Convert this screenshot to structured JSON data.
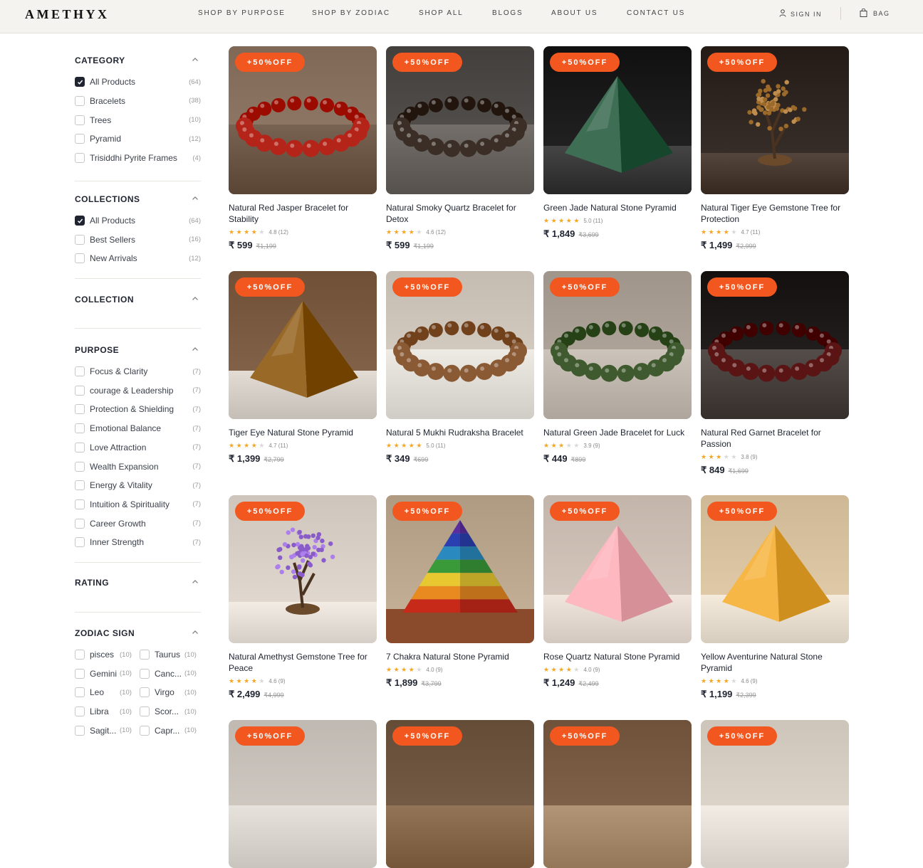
{
  "header": {
    "logo": "AMETHYX",
    "nav": [
      "SHOP BY PURPOSE",
      "SHOP BY ZODIAC",
      "SHOP ALL",
      "BLOGS",
      "ABOUT US",
      "CONTACT US"
    ],
    "sign_in": "SIGN IN",
    "bag": "BAG"
  },
  "filters": {
    "category": {
      "title": "CATEGORY",
      "items": [
        {
          "label": "All Products",
          "count": "(64)",
          "checked": true
        },
        {
          "label": "Bracelets",
          "count": "(38)",
          "checked": false
        },
        {
          "label": "Trees",
          "count": "(10)",
          "checked": false
        },
        {
          "label": "Pyramid",
          "count": "(12)",
          "checked": false
        },
        {
          "label": "Trisiddhi Pyrite Frames",
          "count": "(4)",
          "checked": false
        }
      ]
    },
    "collections": {
      "title": "COLLECTIONS",
      "items": [
        {
          "label": "All Products",
          "count": "(64)",
          "checked": true
        },
        {
          "label": "Best Sellers",
          "count": "(16)",
          "checked": false
        },
        {
          "label": "New Arrivals",
          "count": "(12)",
          "checked": false
        }
      ]
    },
    "collection": {
      "title": "COLLECTION"
    },
    "purpose": {
      "title": "PURPOSE",
      "items": [
        {
          "label": "Focus & Clarity",
          "count": "(7)"
        },
        {
          "label": "courage & Leadership",
          "count": "(7)"
        },
        {
          "label": "Protection & Shielding",
          "count": "(7)"
        },
        {
          "label": "Emotional Balance",
          "count": "(7)"
        },
        {
          "label": "Love Attraction",
          "count": "(7)"
        },
        {
          "label": "Wealth Expansion",
          "count": "(7)"
        },
        {
          "label": "Energy & Vitality",
          "count": "(7)"
        },
        {
          "label": "Intuition & Spirituality",
          "count": "(7)"
        },
        {
          "label": "Career Growth",
          "count": "(7)"
        },
        {
          "label": "Inner Strength",
          "count": "(7)"
        }
      ]
    },
    "rating": {
      "title": "RATING"
    },
    "zodiac": {
      "title": "ZODIAC SIGN",
      "items": [
        {
          "label": "pisces",
          "count": "(10)"
        },
        {
          "label": "Taurus",
          "count": "(10)"
        },
        {
          "label": "Gemini",
          "count": "(10)"
        },
        {
          "label": "Canc...",
          "count": "(10)"
        },
        {
          "label": "Leo",
          "count": "(10)"
        },
        {
          "label": "Virgo",
          "count": "(10)"
        },
        {
          "label": "Libra",
          "count": "(10)"
        },
        {
          "label": "Scor...",
          "count": "(10)"
        },
        {
          "label": "Sagit...",
          "count": "(10)"
        },
        {
          "label": "Capr...",
          "count": "(10)"
        }
      ]
    }
  },
  "badge_text": "+50%OFF",
  "colors": {
    "accent": "#f2571f",
    "star": "#f5a623",
    "text": "#1f2430"
  },
  "products": [
    {
      "name": "Natural Red Jasper Bracelet for Stability",
      "stars": 4,
      "rating": "4.8 (12)",
      "price": "₹ 599",
      "old_price": "₹1,199",
      "image": "bracelet",
      "bg": "#8a7260",
      "surface": "#6e5848",
      "color": "#b52418"
    },
    {
      "name": "Natural Smoky Quartz Bracelet for Detox",
      "stars": 4,
      "rating": "4.6 (12)",
      "price": "₹ 599",
      "old_price": "₹1,199",
      "image": "bracelet",
      "bg": "#4d4946",
      "surface": "#6a6561",
      "color": "#3a2e27"
    },
    {
      "name": "Green Jade Natural Stone Pyramid",
      "stars": 5,
      "rating": "5.0 (11)",
      "price": "₹ 1,849",
      "old_price": "₹3,699",
      "image": "pyramid",
      "bg": "#1a1a1a",
      "surface": "#3b3b3b",
      "color": "#2f5f45"
    },
    {
      "name": "Natural Tiger Eye Gemstone Tree for Protection",
      "stars": 4,
      "rating": "4.7 (11)",
      "price": "₹ 1,499",
      "old_price": "₹2,999",
      "image": "tree",
      "bg": "#2e2520",
      "surface": "#4a3c33",
      "color": "#9b6a2a"
    },
    {
      "name": "Tiger Eye Natural Stone Pyramid",
      "stars": 4,
      "rating": "4.7 (11)",
      "price": "₹ 1,399",
      "old_price": "₹2,799",
      "image": "pyramid",
      "bg": "#7a5a40",
      "surface": "#d8d2ca",
      "color": "#8a5a18"
    },
    {
      "name": "Natural 5 Mukhi Rudraksha Bracelet",
      "stars": 5,
      "rating": "5.0 (11)",
      "price": "₹ 349",
      "old_price": "₹699",
      "image": "bracelet",
      "bg": "#cfc6bb",
      "surface": "#e4e0da",
      "color": "#8a5a35"
    },
    {
      "name": "Natural Green Jade Bracelet for Luck",
      "stars": 3,
      "rating": "3.9 (9)",
      "price": "₹ 449",
      "old_price": "₹899",
      "image": "bracelet",
      "bg": "#a99f94",
      "surface": "#c2bab0",
      "color": "#3f5a2e"
    },
    {
      "name": "Natural Red Garnet Bracelet for Passion",
      "stars": 3,
      "rating": "3.8 (9)",
      "price": "₹ 849",
      "old_price": "₹1,699",
      "image": "bracelet",
      "bg": "#1e1a19",
      "surface": "#4a4340",
      "color": "#5a1414"
    },
    {
      "name": "Natural Amethyst Gemstone Tree for Peace",
      "stars": 4,
      "rating": "4.6 (9)",
      "price": "₹ 2,499",
      "old_price": "₹4,999",
      "image": "tree",
      "bg": "#d8cfc6",
      "surface": "#e8e2da",
      "color": "#8a5cc9"
    },
    {
      "name": "7 Chakra Natural Stone Pyramid",
      "stars": 4,
      "rating": "4.0 (9)",
      "price": "₹ 1,899",
      "old_price": "₹3,799",
      "image": "chakra",
      "bg": "#b9a48c",
      "surface": "#8a4a2c",
      "color": "#d8a040"
    },
    {
      "name": "Rose Quartz Natural Stone Pyramid",
      "stars": 4,
      "rating": "4.0 (9)",
      "price": "₹ 1,249",
      "old_price": "₹2,499",
      "image": "pyramid",
      "bg": "#cdbfb4",
      "surface": "#e6dcd3",
      "color": "#efa9b0"
    },
    {
      "name": "Yellow Aventurine Natural Stone Pyramid",
      "stars": 4,
      "rating": "4.6 (9)",
      "price": "₹ 1,199",
      "old_price": "₹2,399",
      "image": "pyramid",
      "bg": "#d8c2a0",
      "surface": "#ebe1d2",
      "color": "#e8a838"
    },
    {
      "name": "",
      "stars": 0,
      "rating": "",
      "price": "",
      "old_price": "",
      "image": "plain",
      "bg": "#c9c3bc",
      "surface": "#ddd8d2",
      "color": "#aaa"
    },
    {
      "name": "",
      "stars": 0,
      "rating": "",
      "price": "",
      "old_price": "",
      "image": "plain",
      "bg": "#6e5640",
      "surface": "#8a6a4c",
      "color": "#aaa"
    },
    {
      "name": "",
      "stars": 0,
      "rating": "",
      "price": "",
      "old_price": "",
      "image": "plain",
      "bg": "#7a5c44",
      "surface": "#a88a6c",
      "color": "#aaa"
    },
    {
      "name": "",
      "stars": 0,
      "rating": "",
      "price": "",
      "old_price": "",
      "image": "plain",
      "bg": "#d7cfc4",
      "surface": "#e8e2da",
      "color": "#aaa"
    }
  ]
}
